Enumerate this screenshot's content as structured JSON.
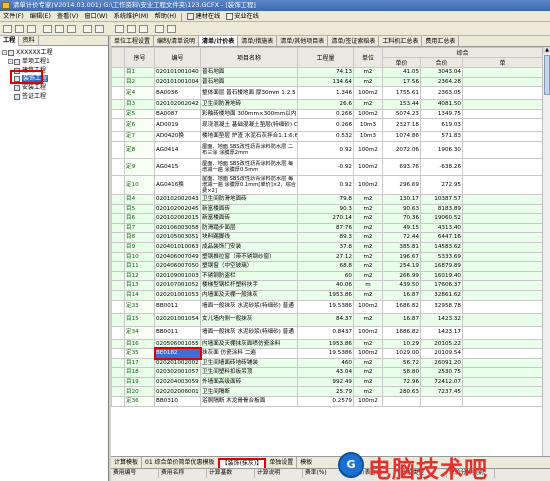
{
  "window": {
    "title": "清单计价专家(V2014.03.001) G:\\工作资料\\安业工程文件夹\\123.GCFX - [装饰工程]"
  },
  "menubar": {
    "items": [
      "文件(F)",
      "编辑(E)",
      "查看(V)",
      "窗口(W)",
      "系统维护(M)",
      "帮助(H)",
      "建材在线",
      "安业在线"
    ]
  },
  "left_panel": {
    "tabs": [
      "工程",
      "资料"
    ],
    "tree": [
      {
        "label": "XXXXXX工程",
        "level": 0,
        "expander": "-"
      },
      {
        "label": "单项工程1",
        "level": 1,
        "expander": "-"
      },
      {
        "label": "建筑工程",
        "level": 2
      },
      {
        "label": "装饰工程",
        "level": 2,
        "selected": true
      },
      {
        "label": "安装工程",
        "level": 2
      },
      {
        "label": "签证工程",
        "level": 2
      }
    ]
  },
  "main_tabs": [
    "单位工程设置",
    "编制/清单说明",
    "清单/计价表",
    "清单/措施表",
    "清单/其他项目表",
    "清单/签证索赔表",
    "工料机汇总表",
    "费用汇总表"
  ],
  "active_main_tab": 2,
  "grid": {
    "group_header": "综合",
    "columns": [
      "序号",
      "编号",
      "项目名称",
      "工程量",
      "单位",
      "单价",
      "合价",
      "单"
    ],
    "rows": [
      {
        "seq": "目1",
        "code": "020101001040",
        "name": "普石地面",
        "qty": "74.13",
        "unit": "m2",
        "price": "41.05",
        "total": "3043.04",
        "hl": true
      },
      {
        "seq": "目2",
        "code": "020101001004",
        "name": "普石地面",
        "qty": "134.64",
        "unit": "m2",
        "price": "17.56",
        "total": "2364.28",
        "hl": true
      },
      {
        "seq": "定4",
        "code": "BA0036",
        "name": "整体面层 普石楼地面 厚30mm 1:2.5",
        "qty": "1.346",
        "unit": "100m2",
        "price": "1755.61",
        "total": "2363.05",
        "tall": true
      },
      {
        "seq": "目3",
        "code": "020102002042",
        "name": "卫生间防滑地砖",
        "qty": "26.6",
        "unit": "m2",
        "price": "153.44",
        "total": "4081.50",
        "hl": true
      },
      {
        "seq": "定5",
        "code": "BA0087",
        "name": "彩釉砖楼地面 300mm×300mm以内",
        "qty": "0.266",
        "unit": "100m2",
        "price": "5074.23",
        "total": "1349.75"
      },
      {
        "seq": "定6",
        "code": "AD0019",
        "name": "现浇混凝土 基础混凝土垫层(特细砂) C10",
        "qty": "0.266",
        "unit": "10m3",
        "price": "2327.18",
        "total": "619.03",
        "tall": true
      },
      {
        "seq": "定7",
        "code": "AD0420换",
        "name": "楼地面垫层 炉渣 水泥石灰拌合1:1:6:6换",
        "qty": "0.532",
        "unit": "10m3",
        "price": "1074.86",
        "total": "571.83"
      },
      {
        "seq": "定8",
        "code": "AG0414",
        "name": "屋面、地面 SBS改性沥青涂料防水层 二布三涂 涂膜厚2mm",
        "qty": "0.92",
        "unit": "100m2",
        "price": "2072.06",
        "total": "1906.30",
        "wrap": true
      },
      {
        "seq": "定9",
        "code": "AG0415",
        "name": "屋面、地面 SBS改性沥青涂料防水层 每增减一遍 涂膜厚0.5mm",
        "qty": "-0.92",
        "unit": "100m2",
        "price": "693.76",
        "total": "-638.26",
        "wrap": true
      },
      {
        "seq": "定10",
        "code": "AG0416换",
        "name": "屋面、地面 SBS改性沥青涂料防水层 每增减一遍 涂膜厚0.1mm[单价]×2，综合费×2]",
        "qty": "0.92",
        "unit": "100m2",
        "price": "296.69",
        "total": "272.95",
        "wrap": true
      },
      {
        "seq": "目4",
        "code": "020102002043",
        "name": "卫生间防滑地面砖",
        "qty": "79.8",
        "unit": "m2",
        "price": "130.17",
        "total": "10387.57",
        "hl": true
      },
      {
        "seq": "目5",
        "code": "020102002045",
        "name": "新富楼面砖",
        "qty": "90.3",
        "unit": "m2",
        "price": "90.63",
        "total": "8183.89",
        "hl": true
      },
      {
        "seq": "目6",
        "code": "020102002015",
        "name": "新富楼面砖",
        "qty": "270.14",
        "unit": "m2",
        "price": "70.36",
        "total": "19060.52",
        "hl": true
      },
      {
        "seq": "目7",
        "code": "020106003058",
        "name": "防滑踏步面层",
        "qty": "87.76",
        "unit": "m2",
        "price": "49.15",
        "total": "4313.40",
        "hl": true
      },
      {
        "seq": "目8",
        "code": "020105003051",
        "name": "块料踢脚线",
        "qty": "89.3",
        "unit": "m2",
        "price": "72.44",
        "total": "6447.16",
        "hl": true
      },
      {
        "seq": "目9",
        "code": "020401010063",
        "name": "成品装饰门安装",
        "qty": "37.8",
        "unit": "m2",
        "price": "385.81",
        "total": "14583.62",
        "hl": true
      },
      {
        "seq": "目10",
        "code": "020406007049",
        "name": "塑钢推拉窗（带不锈钢纱窗）",
        "qty": "27.12",
        "unit": "m2",
        "price": "196.67",
        "total": "5333.69",
        "hl": true
      },
      {
        "seq": "目11",
        "code": "020406007050",
        "name": "塑钢窗（中空玻璃）",
        "qty": "68.8",
        "unit": "m2",
        "price": "254.19",
        "total": "16879.89",
        "hl": true
      },
      {
        "seq": "目12",
        "code": "020109001003",
        "name": "不锈钢防盗栏",
        "qty": "60",
        "unit": "m2",
        "price": "266.99",
        "total": "16019.40",
        "hl": true
      },
      {
        "seq": "目13",
        "code": "020107001052",
        "name": "楼梯型钢栏杆塑料扶手",
        "qty": "40.06",
        "unit": "m",
        "price": "439.50",
        "total": "17606.37",
        "hl": true
      },
      {
        "seq": "目14",
        "code": "020201001053",
        "name": "内墙面及天棚一般抹灰",
        "qty": "1953.86",
        "unit": "m2",
        "price": "16.87",
        "total": "32861.62",
        "hl": true
      },
      {
        "seq": "定33",
        "code": "BB0011",
        "name": "墙面一般抹灰 水泥砂浆(特细砂) 普通",
        "qty": "19.5386",
        "unit": "100m2",
        "price": "1686.82",
        "total": "32958.78",
        "tall": true
      },
      {
        "seq": "目15",
        "code": "020201001054",
        "name": "女儿墙内侧一般抹灰",
        "qty": "84.37",
        "unit": "m2",
        "price": "16.87",
        "total": "1423.32",
        "hl": true,
        "tall": true
      },
      {
        "seq": "定34",
        "code": "BB0011",
        "name": "墙面一般抹灰 水泥砂浆(特细砂) 普通",
        "qty": "0.8437",
        "unit": "100m2",
        "price": "1686.82",
        "total": "1423.17",
        "tall": true
      },
      {
        "seq": "目16",
        "code": "020506001055",
        "name": "内墙面及天棚抹灰面喷仿瓷涂料",
        "qty": "1953.86",
        "unit": "m2",
        "price": "10.29",
        "total": "20105.22",
        "hl": true
      },
      {
        "seq": "定35",
        "code": "BE0182",
        "name": "抹灰面 仿瓷涂料 二遍",
        "qty": "19.5386",
        "unit": "100m2",
        "price": "1029.00",
        "total": "20109.54",
        "active": true
      },
      {
        "seq": "目17",
        "code": "020201002002",
        "name": "卫生间墙面砖地砖铺装",
        "qty": "460",
        "unit": "m2",
        "price": "56.72",
        "total": "26091.20",
        "hl": true
      },
      {
        "seq": "目18",
        "code": "020302001057",
        "name": "卫生间塑料扣板吊顶",
        "qty": "43.04",
        "unit": "m2",
        "price": "58.80",
        "total": "2530.75",
        "hl": true
      },
      {
        "seq": "目19",
        "code": "020204003059",
        "name": "外墙面高级面砖",
        "qty": "992.49",
        "unit": "m2",
        "price": "72.96",
        "total": "72412.07",
        "hl": true
      },
      {
        "seq": "目20",
        "code": "020202006001",
        "name": "卫生间隔断",
        "qty": "25.79",
        "unit": "m2",
        "price": "280.63",
        "total": "7237.45",
        "hl": true
      },
      {
        "seq": "定36",
        "code": "BB0310",
        "name": "浴厕隔断 木龙骨骨合板面",
        "qty": "0.2579",
        "unit": "100m2",
        "price": "",
        "total": ""
      }
    ]
  },
  "bottom_bar": {
    "prefix": "计算模板",
    "template": "01 综合单价简单优惠模板",
    "mode": "【装饰(抹灰)】",
    "tabs": [
      "单独设置",
      "模板"
    ]
  },
  "bottom_grid_headers": [
    "费用编号",
    "费用名称",
    "计算基数",
    "计算说明",
    "费率(%)",
    "计价表方式",
    "计价类型",
    "单价分析类别"
  ],
  "watermark": {
    "icon": "G",
    "text": "电脑技术吧"
  }
}
